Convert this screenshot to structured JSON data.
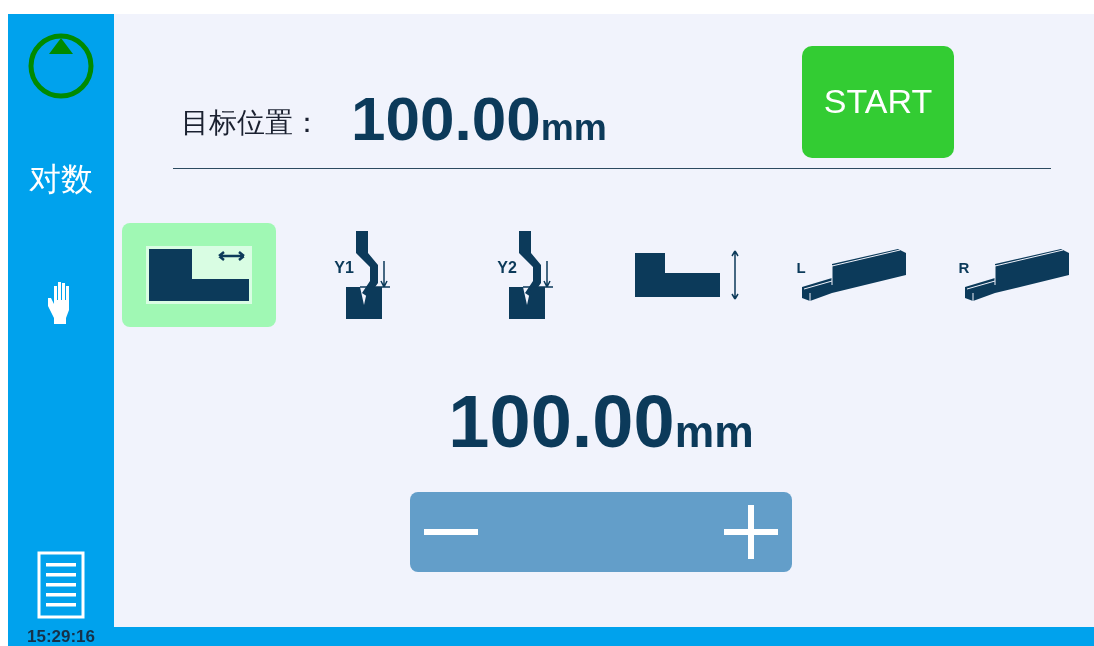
{
  "sidebar": {
    "mode_label": "对数",
    "time": "15:29:16"
  },
  "target": {
    "label": "目标位置：",
    "value": "100.00",
    "unit": "mm"
  },
  "start_button": {
    "label": "START"
  },
  "axes": [
    {
      "kind": "x",
      "selected": true
    },
    {
      "kind": "y",
      "label": "Y1",
      "selected": false
    },
    {
      "kind": "y",
      "label": "Y2",
      "selected": false
    },
    {
      "kind": "r",
      "selected": false
    },
    {
      "kind": "beam",
      "label": "L",
      "selected": false
    },
    {
      "kind": "beam",
      "label": "R",
      "selected": false
    }
  ],
  "current": {
    "value": "100.00",
    "unit": "mm"
  }
}
